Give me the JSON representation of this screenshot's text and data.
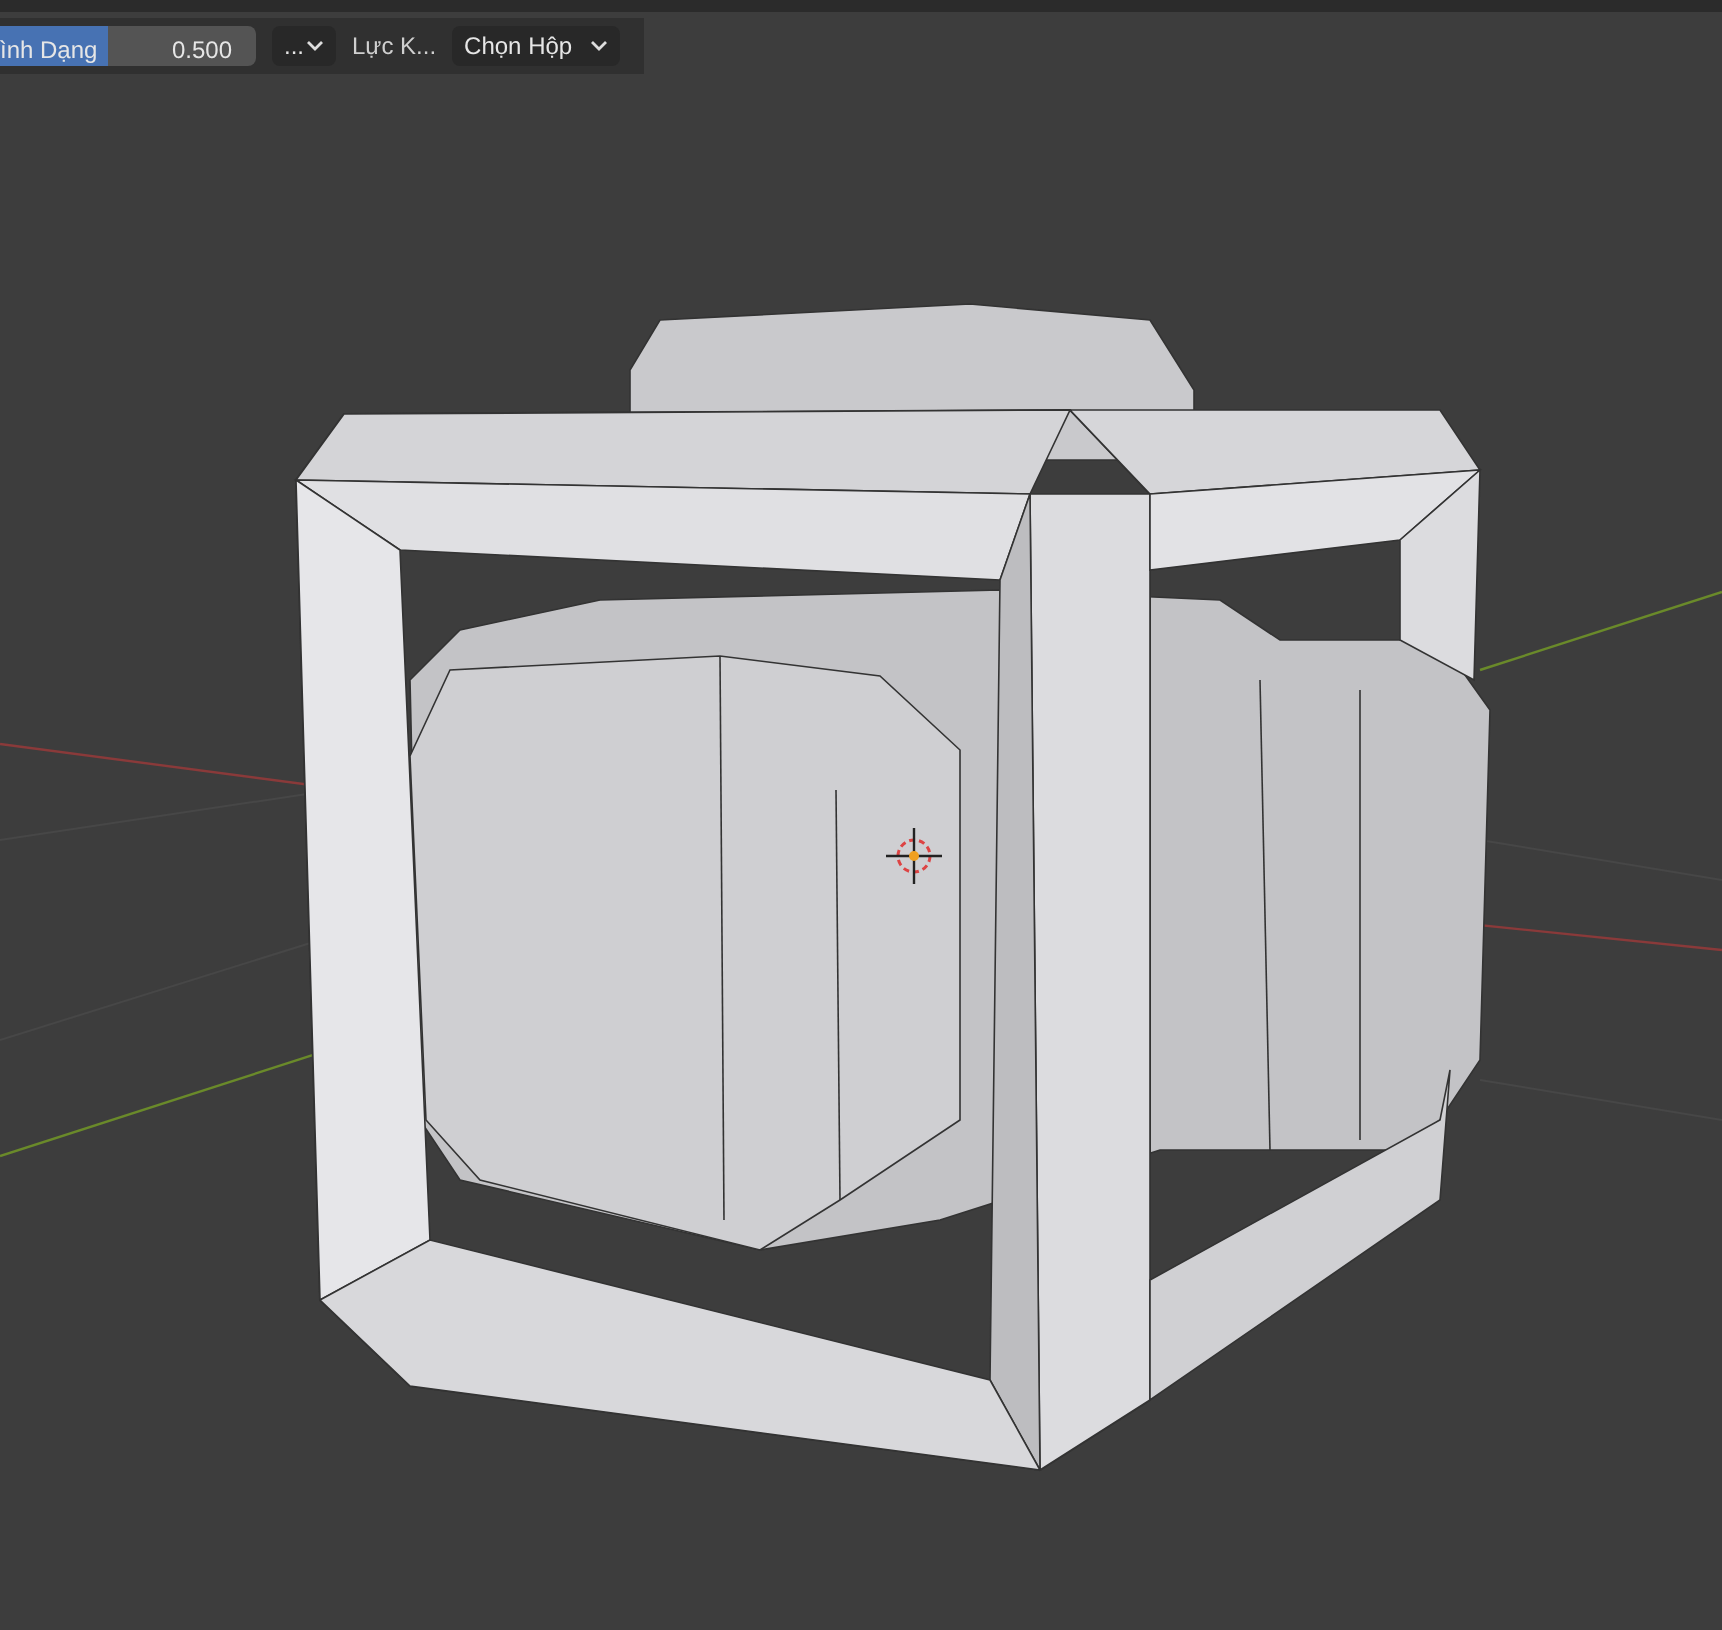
{
  "tool_options": {
    "shape_slider": {
      "label": "ình Dạng",
      "value": "0.500",
      "level": 0.42
    },
    "more_dropdown": {
      "label": "..."
    },
    "force_label": "Lực K...",
    "select_dropdown": {
      "label": "Chọn Hộp"
    }
  }
}
